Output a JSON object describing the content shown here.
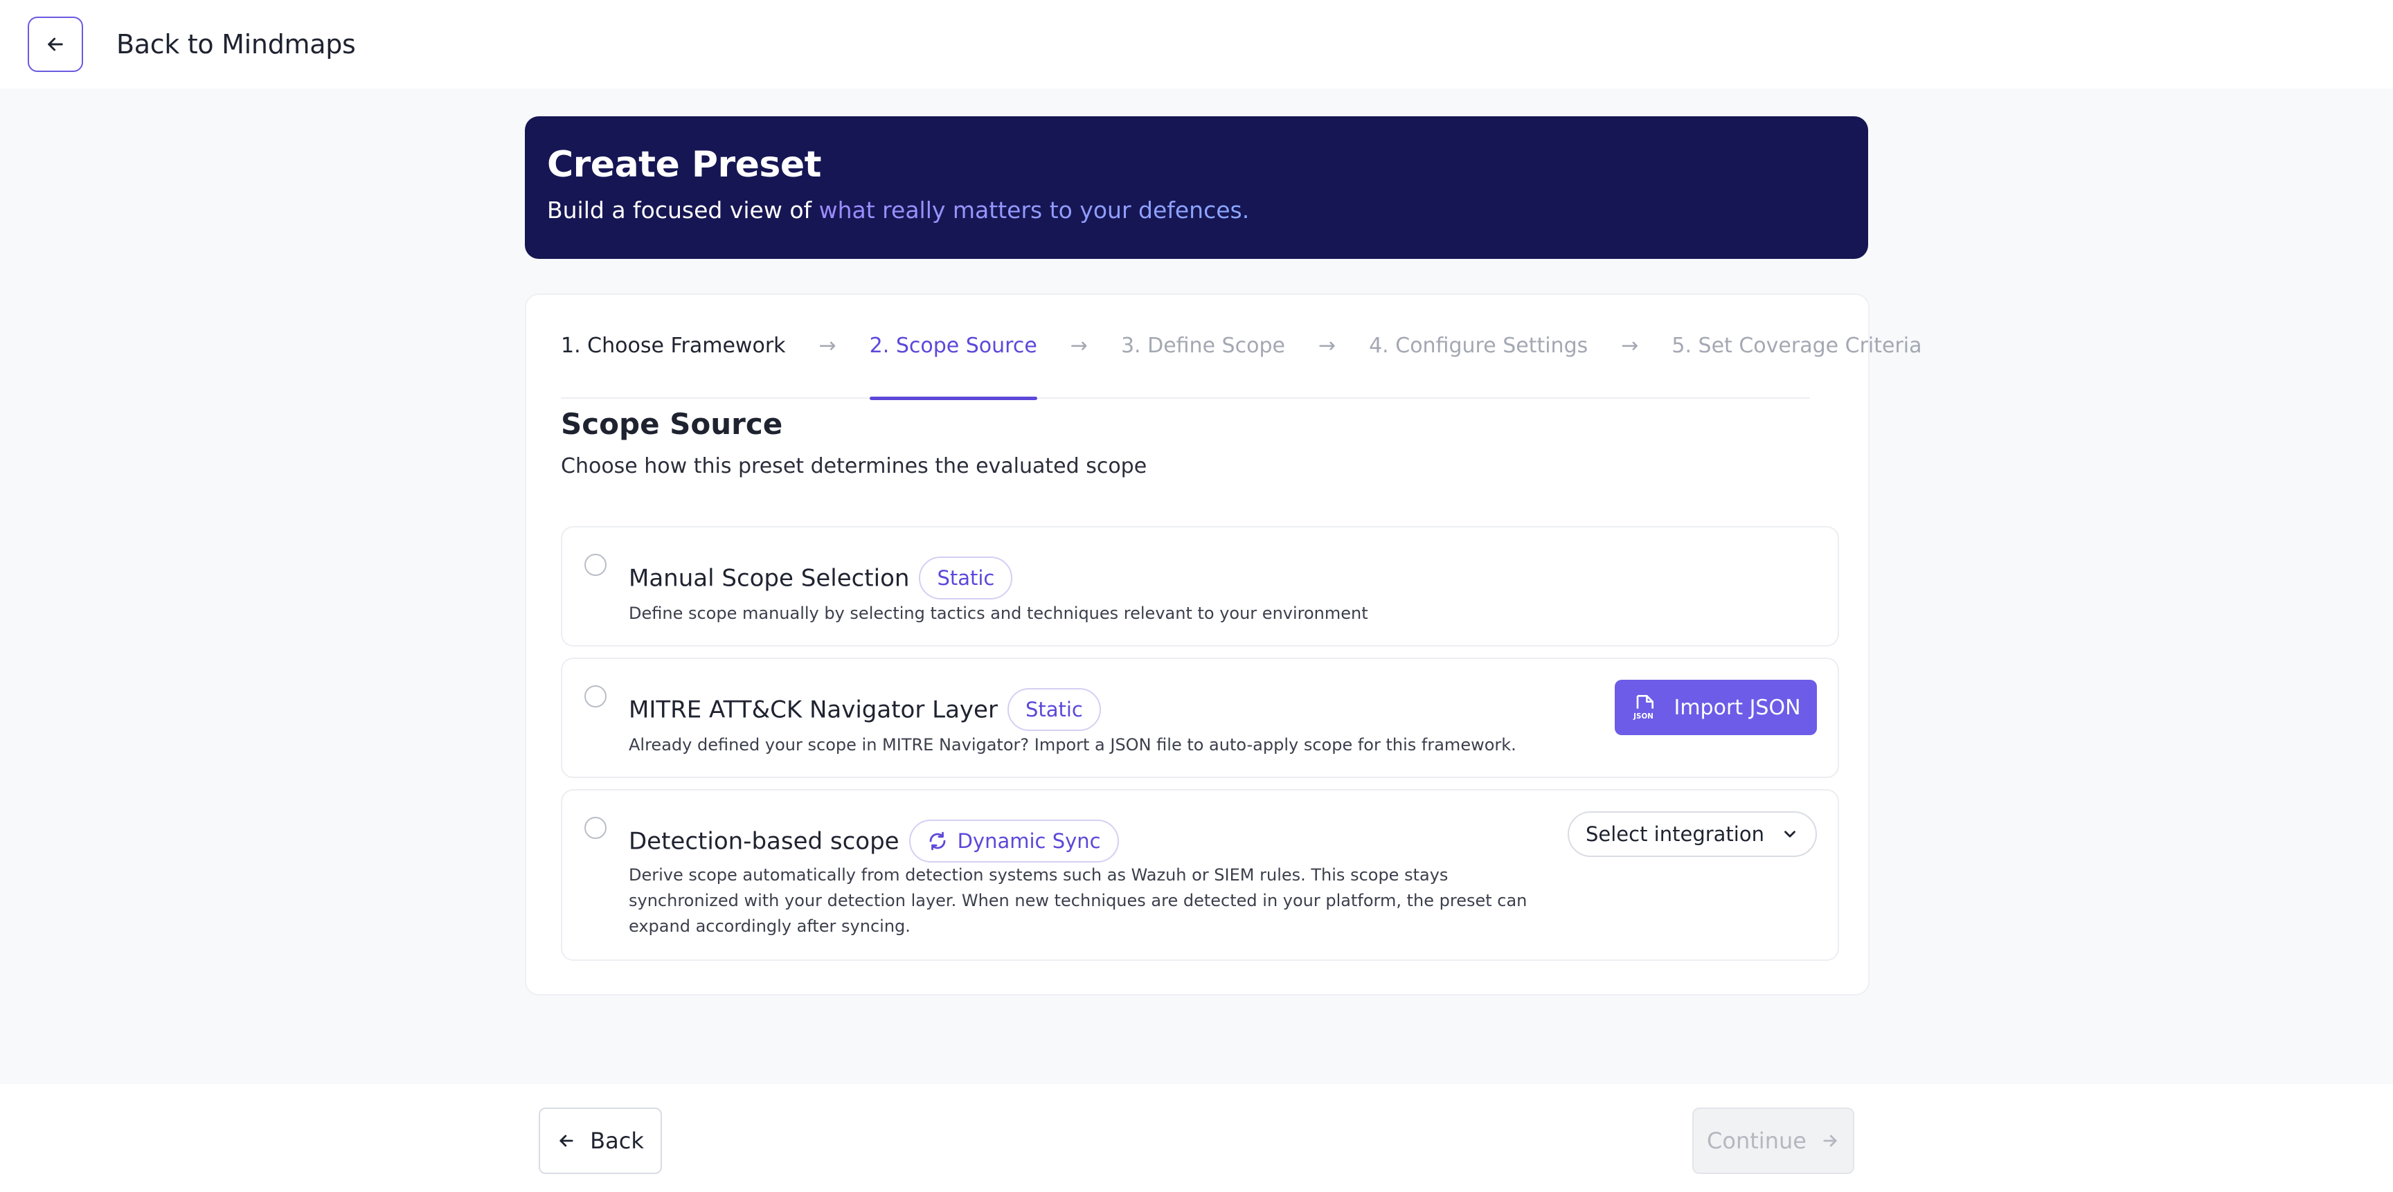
{
  "header": {
    "back_link": "Back to Mindmaps"
  },
  "hero": {
    "title": "Create Preset",
    "subtitle_prefix": "Build a focused view of ",
    "subtitle_highlight": "what really matters to your defences."
  },
  "stepper": {
    "steps": [
      {
        "label": "1. Choose Framework",
        "state": "done"
      },
      {
        "label": "2. Scope Source",
        "state": "active"
      },
      {
        "label": "3. Define Scope",
        "state": "todo"
      },
      {
        "label": "4. Configure Settings",
        "state": "todo"
      },
      {
        "label": "5. Set Coverage Criteria",
        "state": "todo"
      }
    ],
    "arrow": "→"
  },
  "section": {
    "title": "Scope Source",
    "description": "Choose how this preset determines the evaluated scope"
  },
  "options": [
    {
      "title": "Manual Scope Selection",
      "badge": "Static",
      "description": "Define scope manually by selecting tactics and techniques relevant to your environment"
    },
    {
      "title": "MITRE ATT&CK Navigator Layer",
      "badge": "Static",
      "description": "Already defined your scope in MITRE Navigator? Import a JSON file to auto-apply scope for this framework.",
      "action": "Import JSON"
    },
    {
      "title": "Detection-based scope",
      "badge": "Dynamic Sync",
      "description_lines": [
        "Derive scope automatically from detection systems such as Wazuh or SIEM rules. This scope stays",
        "synchronized with your detection layer. When new techniques are detected in your platform, the preset can",
        "expand accordingly after syncing."
      ],
      "select_value": "Select integration"
    }
  ],
  "footer": {
    "back_label": "Back",
    "continue_label": "Continue"
  },
  "colors": {
    "accent": "#5b48d9",
    "button_primary": "#6c5ce7",
    "hero_bg": "#161654",
    "page_bg": "#f8f9fb"
  },
  "icons": [
    "arrow-left-icon",
    "json-file-icon",
    "sync-icon",
    "chevron-down-icon",
    "arrow-right-icon"
  ]
}
